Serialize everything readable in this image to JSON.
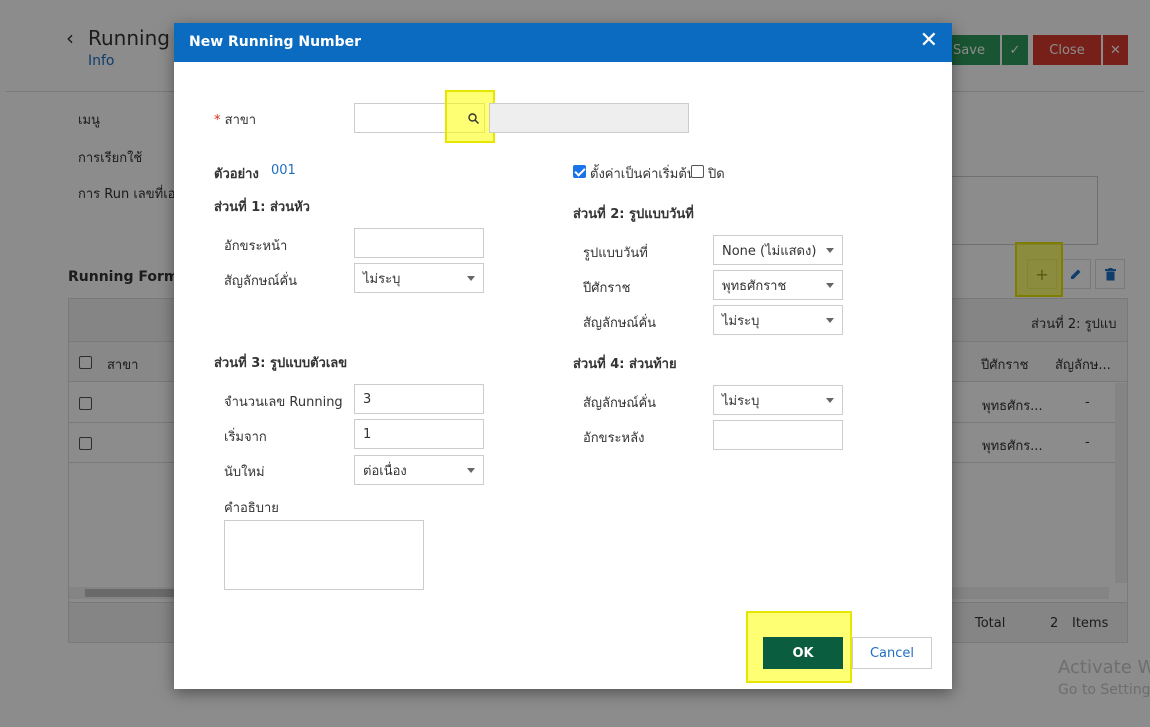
{
  "background": {
    "title": "Running N",
    "subtitle": "Info",
    "save_label": "Save",
    "close_label": "Close",
    "field_labels": [
      "เมนู",
      "การเรียกใช้",
      "การ Run เลขที่เอก"
    ],
    "section_title": "Running Forma",
    "grid": {
      "band_label": "ส่วนที่ 2: รูปแบ",
      "headers": [
        "สาขา",
        "ปีศักราช",
        "สัญลักษ..."
      ],
      "rows": [
        {
          "year": "พุทธศักร...",
          "symbol": "-"
        },
        {
          "year": "พุทธศักร...",
          "symbol": "-"
        }
      ],
      "footer_total_label": "Total",
      "footer_count": "2",
      "footer_items_label": "Items"
    },
    "watermark_line1": "Activate W",
    "watermark_line2": "Go to Setting"
  },
  "modal": {
    "title": "New Running Number",
    "branch_label": "สาขา",
    "branch_required_mark": "*",
    "example_label": "ตัวอย่าง",
    "example_value": "001",
    "default_checkbox_label": "ตั้งค่าเป็นค่าเริ่มต้น",
    "default_checked": true,
    "close_checkbox_label": "ปิด",
    "close_checked": false,
    "part1": {
      "title": "ส่วนที่ 1: ส่วนหัว",
      "prefix_label": "อักขระหน้า",
      "prefix_value": "",
      "separator_label": "สัญลักษณ์คั่น",
      "separator_value": "ไม่ระบุ"
    },
    "part2": {
      "title": "ส่วนที่ 2: รูปแบบวันที่",
      "date_format_label": "รูปแบบวันที่",
      "date_format_value": "None (ไม่แสดง)",
      "era_label": "ปีศักราช",
      "era_value": "พุทธศักราช",
      "separator_label": "สัญลักษณ์คั่น",
      "separator_value": "ไม่ระบุ"
    },
    "part3": {
      "title": "ส่วนที่ 3: รูปแบบตัวเลข",
      "digits_label": "จำนวนเลข Running",
      "digits_value": "3",
      "start_label": "เริ่มจาก",
      "start_value": "1",
      "reset_label": "นับใหม่",
      "reset_value": "ต่อเนื่อง",
      "description_label": "คำอธิบาย",
      "description_value": ""
    },
    "part4": {
      "title": "ส่วนที่ 4: ส่วนท้าย",
      "separator_label": "สัญลักษณ์คั่น",
      "separator_value": "ไม่ระบุ",
      "suffix_label": "อักขระหลัง",
      "suffix_value": ""
    },
    "ok_label": "OK",
    "cancel_label": "Cancel"
  },
  "icons": {
    "back": "chevron-left-icon",
    "check": "check-icon",
    "close": "close-icon",
    "add": "plus-icon",
    "edit": "pencil-icon",
    "delete": "trash-icon",
    "search": "search-icon"
  },
  "colors": {
    "header_blue": "#0a6bc0",
    "ok_green": "#0b5d3f",
    "save_green": "#2e9b5c",
    "close_red": "#d93a2e",
    "highlight_yellow": "#ffff00",
    "link_blue": "#1e6fc2"
  }
}
